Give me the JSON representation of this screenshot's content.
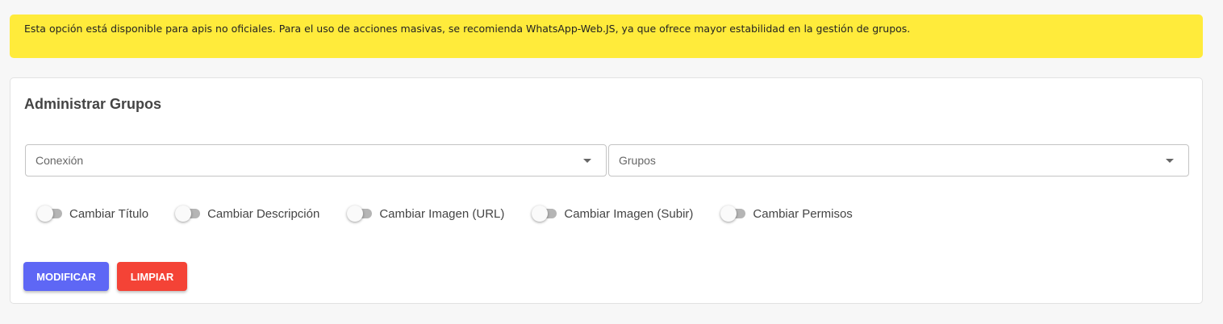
{
  "notice": {
    "text": "Esta opción está disponible para apis no oficiales. Para el uso de acciones masivas, se recomienda WhatsApp-Web.JS, ya que ofrece mayor estabilidad en la gestión de grupos.",
    "color": "#ffeb3b"
  },
  "card": {
    "title": "Administrar Grupos"
  },
  "selects": {
    "conexion": {
      "label": "Conexión",
      "value": ""
    },
    "grupos": {
      "label": "Grupos",
      "value": ""
    }
  },
  "toggles": [
    {
      "label": "Cambiar Título",
      "checked": false
    },
    {
      "label": "Cambiar Descripción",
      "checked": false
    },
    {
      "label": "Cambiar Imagen (URL)",
      "checked": false
    },
    {
      "label": "Cambiar Imagen (Subir)",
      "checked": false
    },
    {
      "label": "Cambiar Permisos",
      "checked": false
    }
  ],
  "buttons": {
    "modificar": {
      "label": "MODIFICAR",
      "color": "#5e67f5"
    },
    "limpiar": {
      "label": "LIMPIAR",
      "color": "#f44336"
    }
  },
  "icons": {
    "dropdown": "chevron-down-icon"
  }
}
